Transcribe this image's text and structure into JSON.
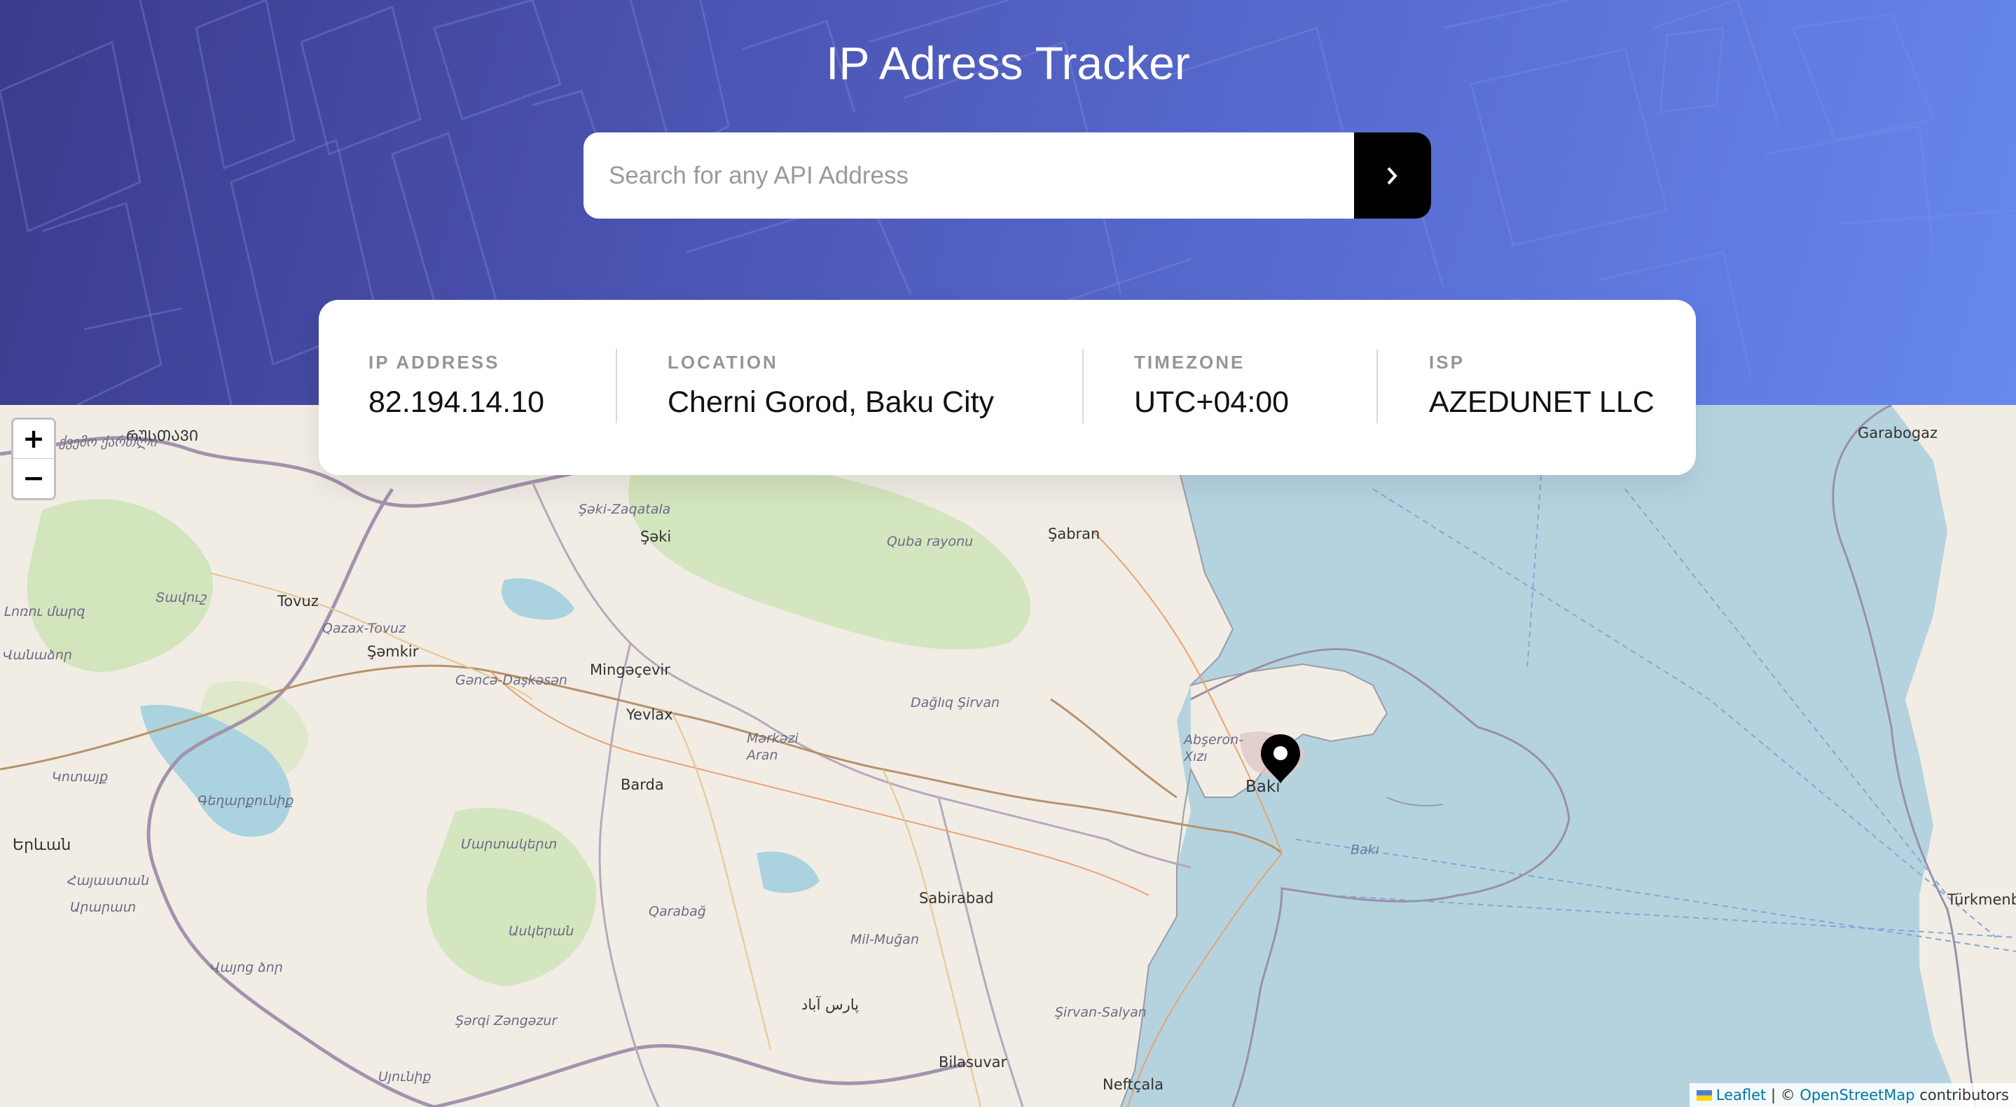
{
  "header": {
    "title": "IP Adress Tracker",
    "background_colors": [
      "#3c3a8c",
      "#6788ee"
    ]
  },
  "search": {
    "placeholder": "Search for any API Address",
    "value": "",
    "submit_icon": "chevron-right-icon"
  },
  "info": {
    "ip_label": "IP ADDRESS",
    "ip_value": "82.194.14.10",
    "location_label": "LOCATION",
    "location_value": "Cherni Gorod, Baku City",
    "timezone_label": "TIMEZONE",
    "timezone_value": "UTC+04:00",
    "isp_label": "ISP",
    "isp_value": "AZEDUNET LLC"
  },
  "map": {
    "zoom_in": "+",
    "zoom_out": "−",
    "marker_icon": "location-pin-icon",
    "labels": {
      "l1": "Garabogaz",
      "l2": "Şəki-Zaqatala",
      "l3": "Şəki",
      "l4": "Quba rayonu",
      "l5": "Şabran",
      "l6": "Tovuz",
      "l7": "Qazax-Tovuz",
      "l8": "Şəmkir",
      "l9": "Gəncə-Daşkəsən",
      "l10": "Mingəçevir",
      "l11": "Yevlax",
      "l12": "Dağlıq Şirvan",
      "l13": "Mərkəzi Aran",
      "l14": "Abşeron-Xızı",
      "l15": "Bakı",
      "l16": "Bakı",
      "l17": "Barda",
      "l18": "Sabirabad",
      "l19": "Qarabağ",
      "l20": "Mil-Muğan",
      "l21": "Şirvan-Salyan",
      "l22": "Bilasuvar",
      "l23": "Neftçala",
      "l24": "Şərqi Zəngəzur",
      "l25": "Türkmenba",
      "l26": "Երևան",
      "l27": "Հայաստան",
      "l28": "Սյունիք",
      "l29": "Վայոց ձոր",
      "l30": "Արարատ",
      "l31": "Գեղարքունիք",
      "l32": "Տավուշ",
      "l33": "Լոռու մարզ",
      "l34": "Վանաձոր",
      "l35": "Կոտայք",
      "l36": "ᲠᲣᲡᲗᲐᲕᲘ",
      "l37": "ქვემო ქართლი",
      "l38": "Մարտակերտ",
      "l39": "Ասկերան",
      "l40": "پارس آباد"
    },
    "attribution_leaflet": "Leaflet",
    "attribution_sep": " | © ",
    "attribution_osm": "OpenStreetMap",
    "attribution_suffix": " contributors"
  }
}
